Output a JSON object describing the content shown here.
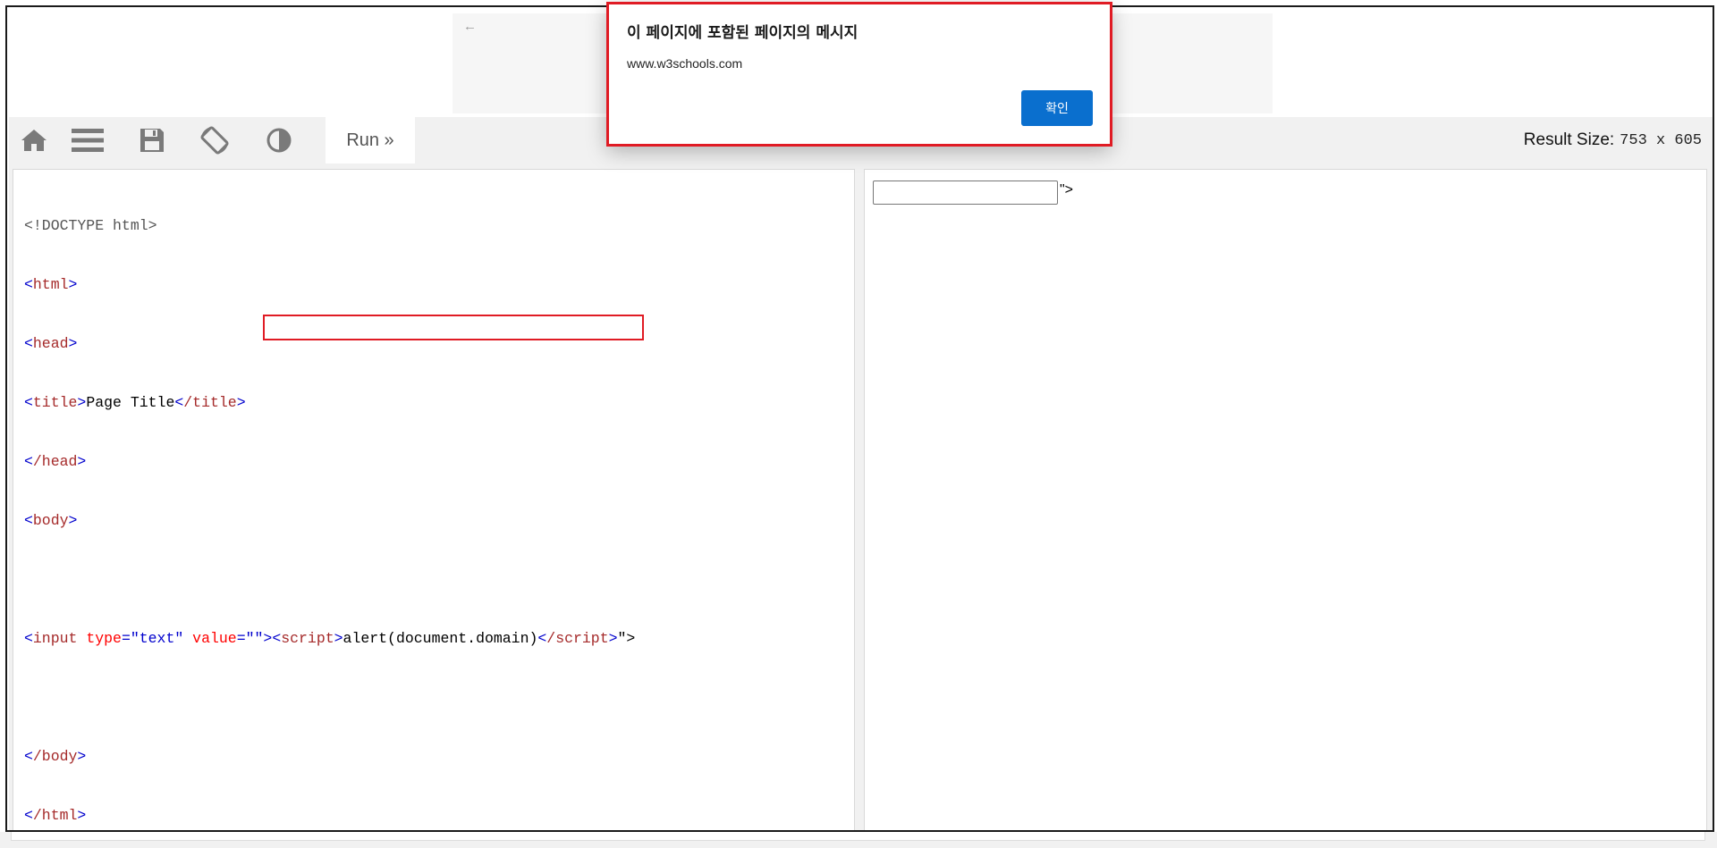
{
  "toolbar": {
    "icons": [
      "home-icon",
      "menu-icon",
      "save-icon",
      "rotate-icon",
      "contrast-icon"
    ],
    "run_label": "Run »",
    "result_size_label": "Result Size:",
    "result_size_value": "753 x 605"
  },
  "ad": {
    "back_glyph": "←"
  },
  "editor": {
    "line1": "<!DOCTYPE html>",
    "line2_open": "<",
    "line2_tag": "html",
    "line2_close": ">",
    "line3_tag": "head",
    "line4_tag": "title",
    "line4_text": "Page Title",
    "line4_end_tag": "/title",
    "line5_tag": "/head",
    "line6_tag": "body",
    "line8_tag": "input",
    "line8_attr1": "type",
    "line8_val1": "\"text\"",
    "line8_attr2": "value",
    "line8_val2_open": "\"",
    "line8_payload_gt": "\">",
    "line8_script_tag": "script",
    "line8_script_text": "alert(document.domain)",
    "line8_script_end": "/script",
    "line8_tail": "\">",
    "line10_tag": "/body",
    "line11_tag": "/html"
  },
  "result": {
    "input_value": "",
    "tail_text": "\">"
  },
  "alert": {
    "title": "이 페이지에 포함된 페이지의 메시지",
    "message": "www.w3schools.com",
    "ok_label": "확인"
  },
  "colors": {
    "highlight": "#e01b24",
    "ok_button": "#0a6fce",
    "toolbar_bg": "#f1f1f1"
  }
}
